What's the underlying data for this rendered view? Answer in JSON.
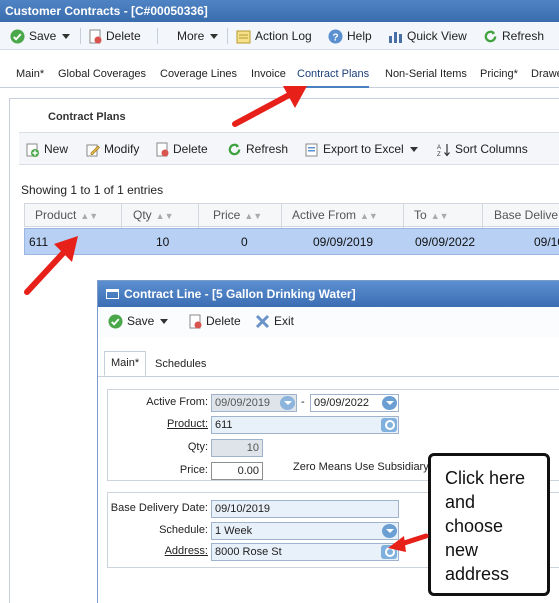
{
  "window": {
    "title": "Customer Contracts - [C#00050336]"
  },
  "toolbar": {
    "save": "Save",
    "delete": "Delete",
    "more": "More",
    "action_log": "Action Log",
    "help": "Help",
    "quick_view": "Quick View",
    "refresh": "Refresh"
  },
  "tabs": [
    "Main*",
    "Global Coverages",
    "Coverage Lines",
    "Invoice",
    "Contract Plans",
    "Non-Serial Items",
    "Pricing*",
    "Drawe"
  ],
  "panel": {
    "title": "Contract Plans",
    "toolbar": {
      "new": "New",
      "modify": "Modify",
      "delete": "Delete",
      "refresh": "Refresh",
      "export": "Export to Excel",
      "sort": "Sort Columns"
    },
    "showing": "Showing 1 to 1 of 1 entries",
    "columns": [
      "Product",
      "Qty",
      "Price",
      "Active From",
      "To",
      "Base Delive"
    ],
    "rows": [
      {
        "product": "611",
        "qty": "10",
        "price": "0",
        "active_from": "09/09/2019",
        "to": "09/09/2022",
        "base_delivery": "09/10"
      }
    ]
  },
  "dialog": {
    "title": "Contract Line - [5 Gallon Drinking Water]",
    "toolbar": {
      "save": "Save",
      "delete": "Delete",
      "exit": "Exit"
    },
    "tabs": [
      "Main*",
      "Schedules"
    ],
    "fields": {
      "active_from_label": "Active From:",
      "active_from": "09/09/2019",
      "date_sep": "-",
      "active_to": "09/09/2022",
      "product_label": "Product:",
      "product": "611",
      "qty_label": "Qty:",
      "qty": "10",
      "price_label": "Price:",
      "price": "0.00",
      "zero_note": "Zero Means Use Subsidiary",
      "base_delivery_label": "Base Delivery Date:",
      "base_delivery": "09/10/2019",
      "schedule_label": "Schedule:",
      "schedule": "1 Week",
      "address_label": "Address:",
      "address": "8000 Rose St"
    }
  },
  "callout": {
    "text": "Click here and choose new address"
  },
  "colors": {
    "accent": "#3a6cae",
    "selected_row": "#b7d0f3",
    "arrow": "#e8201a"
  }
}
